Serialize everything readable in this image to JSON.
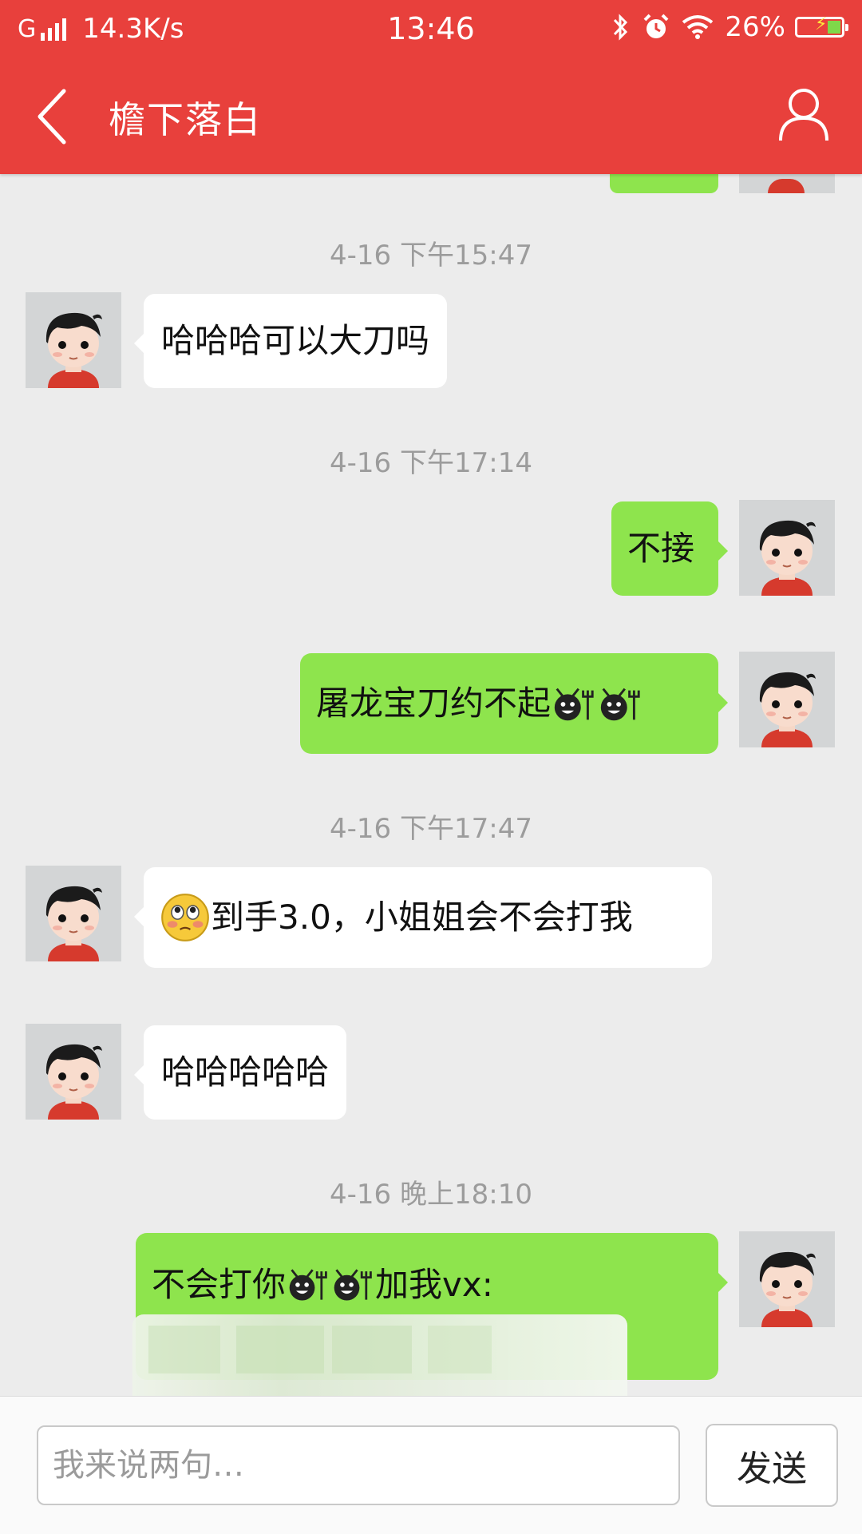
{
  "status_bar": {
    "network": "G",
    "speed": "14.3K/s",
    "time": "13:46",
    "battery": "26%",
    "battery_fill_percent": 26
  },
  "navbar": {
    "title": "檐下落白",
    "back_icon": "chevron-left-icon",
    "profile_icon": "user-profile-icon"
  },
  "colors": {
    "header": "#e8403c",
    "outgoing_bubble": "#8ee44d",
    "incoming_bubble": "#ffffff",
    "chat_background": "#ececec",
    "timestamp": "#9c9c9c"
  },
  "messages": {
    "t1": "4-16 下午15:47",
    "m1": "哈哈哈可以大刀吗",
    "t2": "4-16 下午17:14",
    "m2": "不接",
    "m3": "屠龙宝刀约不起",
    "t3": "4-16 下午17:47",
    "m4": "到手3.0，小姐姐会不会打我",
    "m5": "哈哈哈哈哈",
    "t4": "4-16  晚上18:10",
    "m6a": "不会打你",
    "m6b": "加我vx:"
  },
  "input": {
    "placeholder": "我来说两句…",
    "value": ""
  },
  "send_label": "发送"
}
